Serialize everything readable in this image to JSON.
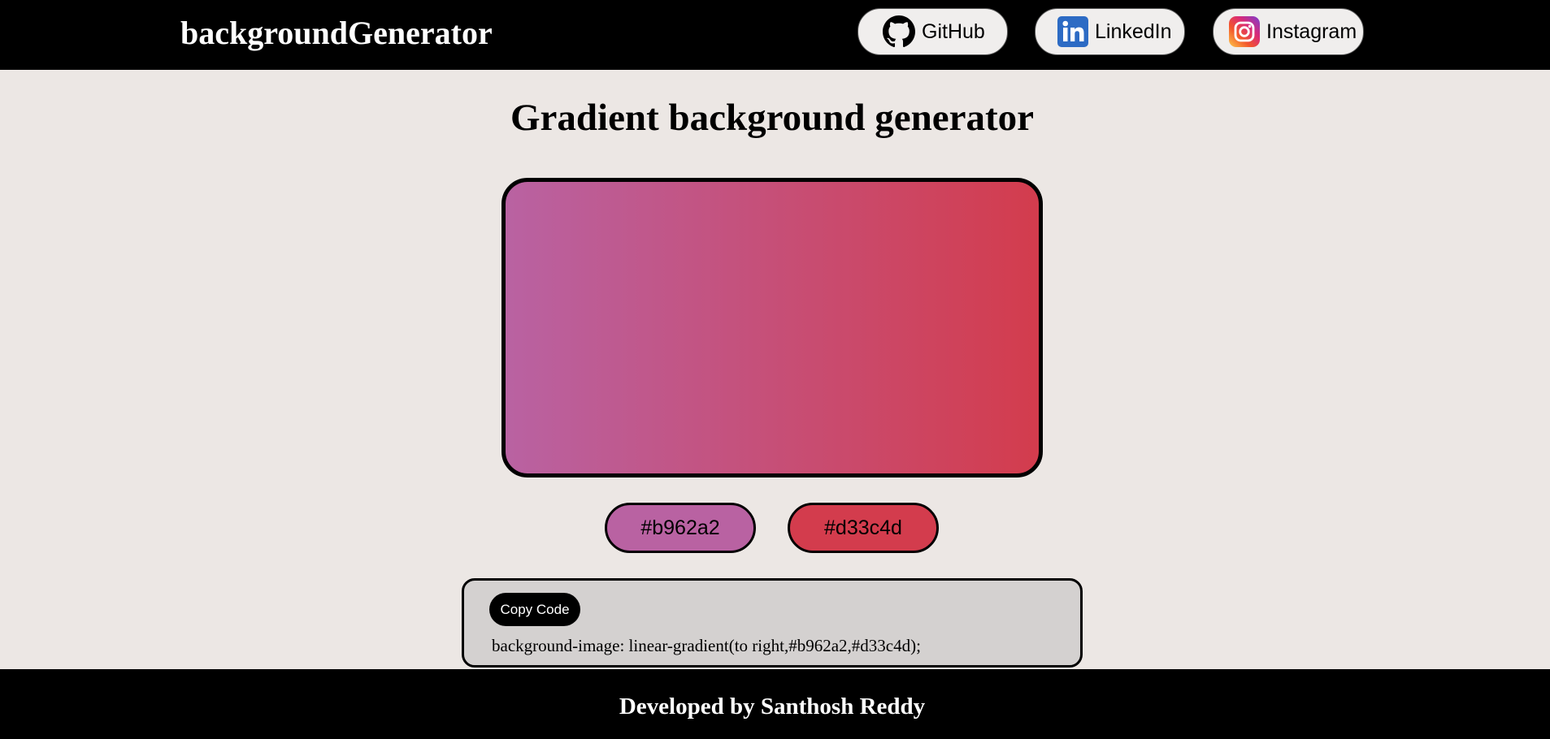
{
  "header": {
    "brand": "backgroundGenerator",
    "links": [
      {
        "label": "GitHub",
        "icon": "github-icon"
      },
      {
        "label": "LinkedIn",
        "icon": "linkedin-icon"
      },
      {
        "label": "Instagram",
        "icon": "instagram-icon"
      }
    ]
  },
  "main": {
    "title": "Gradient background generator",
    "color1": "#b962a2",
    "color2": "#d33c4d",
    "gradient_direction": "to right",
    "copy_button": "Copy Code",
    "css_code": "background-image: linear-gradient(to right,#b962a2,#d33c4d);"
  },
  "footer": {
    "text": "Developed by Santhosh Reddy"
  },
  "colors": {
    "page_background": "#ece7e4",
    "header_background": "#000000",
    "code_box_background": "#d4d1d0"
  }
}
